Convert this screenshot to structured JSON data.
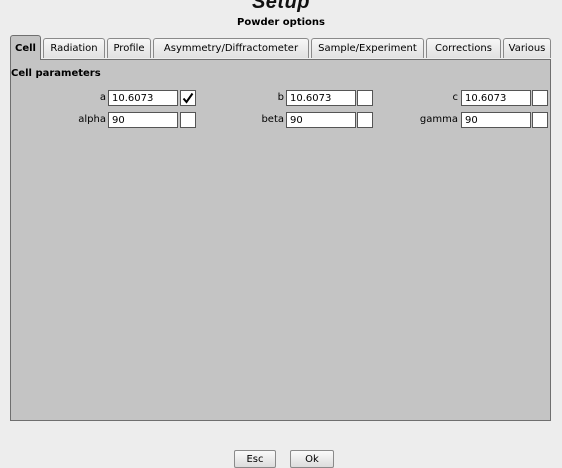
{
  "header": {
    "top_fragment": "Setup"
  },
  "dialog": {
    "title": "Powder options"
  },
  "tabs": [
    {
      "label": "Cell",
      "active": true
    },
    {
      "label": "Radiation",
      "active": false
    },
    {
      "label": "Profile",
      "active": false
    },
    {
      "label": "Asymmetry/Diffractometer",
      "active": false
    },
    {
      "label": "Sample/Experiment",
      "active": false
    },
    {
      "label": "Corrections",
      "active": false
    },
    {
      "label": "Various",
      "active": false
    }
  ],
  "cell": {
    "section_title": "Cell parameters",
    "params": [
      {
        "label": "a",
        "value": "10.6073",
        "refine": true
      },
      {
        "label": "b",
        "value": "10.6073",
        "refine": false
      },
      {
        "label": "c",
        "value": "10.6073",
        "refine": false
      },
      {
        "label": "alpha",
        "value": "90",
        "refine": false
      },
      {
        "label": "beta",
        "value": "90",
        "refine": false
      },
      {
        "label": "gamma",
        "value": "90",
        "refine": false
      }
    ]
  },
  "buttons": {
    "esc": "Esc",
    "ok": "Ok"
  }
}
